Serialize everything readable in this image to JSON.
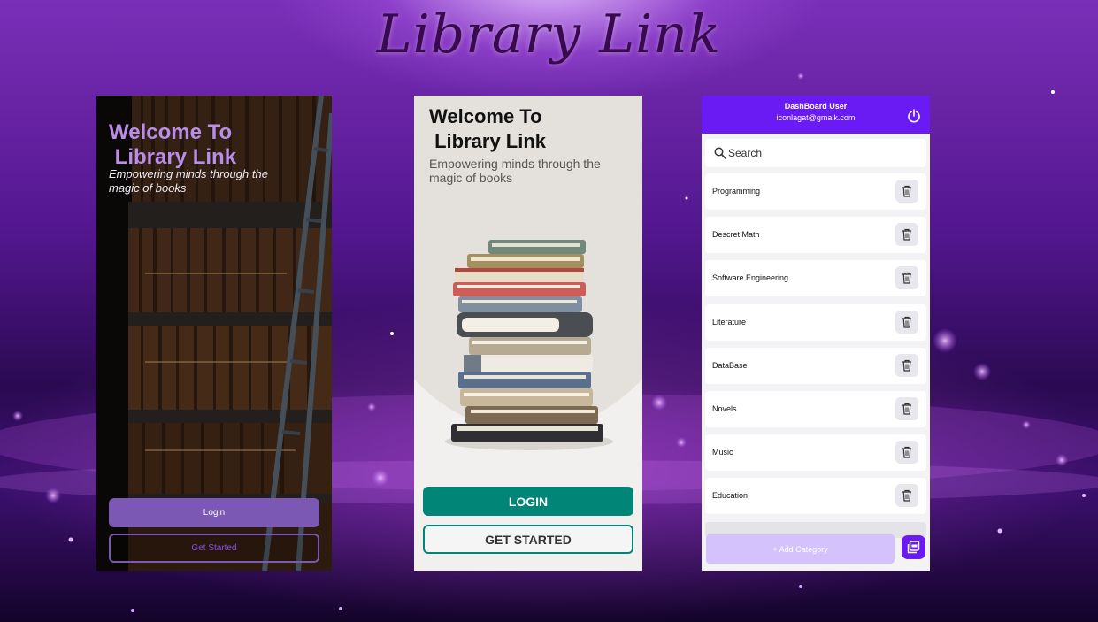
{
  "brand_title": "Library Link",
  "colors": {
    "purple_primary": "#6a1bf4",
    "teal_primary": "#008577",
    "lavender_button": "#7a58b4",
    "light_lavender": "#d4c2fc"
  },
  "screen1": {
    "title_line1": "Welcome To",
    "title_line2": " Library Link",
    "subtitle": "Empowering minds through the magic of books",
    "login_label": "Login",
    "get_started_label": "Get Started"
  },
  "screen2": {
    "title_line1": "Welcome To",
    "title_line2": " Library Link",
    "subtitle": "Empowering minds through the magic of books",
    "login_label": "LOGIN",
    "get_started_label": "GET STARTED"
  },
  "screen3": {
    "header": {
      "user_title": "DashBoard User",
      "email": "iconlagat@gmaik.com",
      "logout_icon": "power-icon"
    },
    "search": {
      "placeholder": "Search",
      "icon": "search-icon"
    },
    "categories": [
      {
        "name": "Programming"
      },
      {
        "name": "Descret Math"
      },
      {
        "name": "Software Engineering"
      },
      {
        "name": "Literature"
      },
      {
        "name": "DataBase"
      },
      {
        "name": "Novels"
      },
      {
        "name": "Music"
      },
      {
        "name": "Education"
      }
    ],
    "delete_icon": "trash-icon",
    "add_category_label": "+ Add Category",
    "fab_icon": "add-pdf-icon"
  }
}
